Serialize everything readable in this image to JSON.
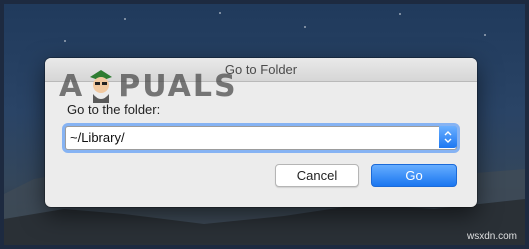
{
  "dialog": {
    "title": "Go to Folder",
    "prompt_label": "Go to the folder:",
    "path_value": "~/Library/",
    "cancel_label": "Cancel",
    "go_label": "Go"
  },
  "watermark": {
    "brand_left": "A",
    "brand_right": "PUALS",
    "site": "wsxdn.com"
  },
  "colors": {
    "accent": "#1a76f0",
    "focus_ring": "#64a0f5",
    "dialog_bg": "#ececec"
  },
  "icons": {
    "dropdown": "chevron-up-down-icon",
    "mascot": "appuals-mascot-icon"
  }
}
